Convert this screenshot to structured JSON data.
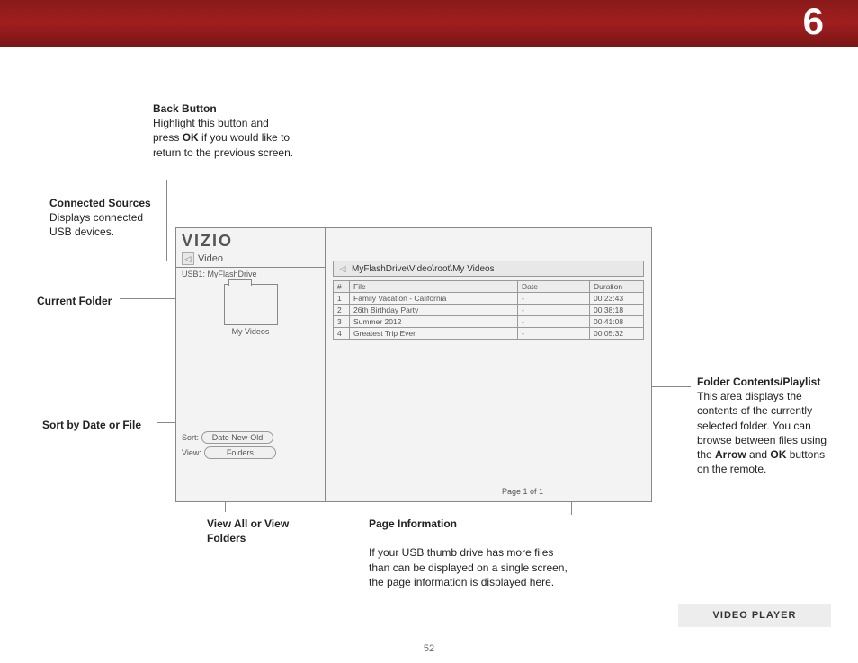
{
  "chapter_number": "6",
  "page_number": "52",
  "footer_label": "VIDEO PLAYER",
  "annotations": {
    "back_button": {
      "title": "Back Button",
      "body_1": "Highlight this button and press ",
      "bold_1": "OK",
      "body_2": " if you would like to return to the previous screen."
    },
    "connected_sources": {
      "title": "Connected Sources",
      "body": "Displays connected USB devices."
    },
    "current_folder": {
      "title": "Current Folder"
    },
    "sort": {
      "title": "Sort by Date or File"
    },
    "view": {
      "title": "View All or View Folders"
    },
    "page_info": {
      "title": "Page Information",
      "body": "If your USB thumb drive has more files than can be displayed on a single screen, the page information is displayed here."
    },
    "folder_contents": {
      "title": "Folder Contents/Playlist",
      "body_1": "This area displays the contents of the currently selected folder. You can browse between files using the ",
      "bold_1": "Arrow",
      "body_2": " and ",
      "bold_2": "OK",
      "body_3": " buttons on the remote."
    }
  },
  "panel": {
    "logo": "VIZIO",
    "mode": "Video",
    "source": "USB1: MyFlashDrive",
    "folder_label": "My Videos",
    "sort_label": "Sort:",
    "sort_value": "Date New-Old",
    "view_label": "View:",
    "view_value": "Folders",
    "breadcrumb": "MyFlashDrive\\Video\\root\\My Videos",
    "columns": {
      "num": "#",
      "file": "File",
      "date": "Date",
      "duration": "Duration"
    },
    "rows": [
      {
        "n": "1",
        "file": "Family Vacation - California",
        "date": "-",
        "dur": "00:23:43"
      },
      {
        "n": "2",
        "file": "26th Birthday Party",
        "date": "-",
        "dur": "00:38:18"
      },
      {
        "n": "3",
        "file": "Summer 2012",
        "date": "-",
        "dur": "00:41:08"
      },
      {
        "n": "4",
        "file": "Greatest Trip Ever",
        "date": "-",
        "dur": "00:05:32"
      }
    ],
    "page_info": "Page 1 of 1"
  }
}
